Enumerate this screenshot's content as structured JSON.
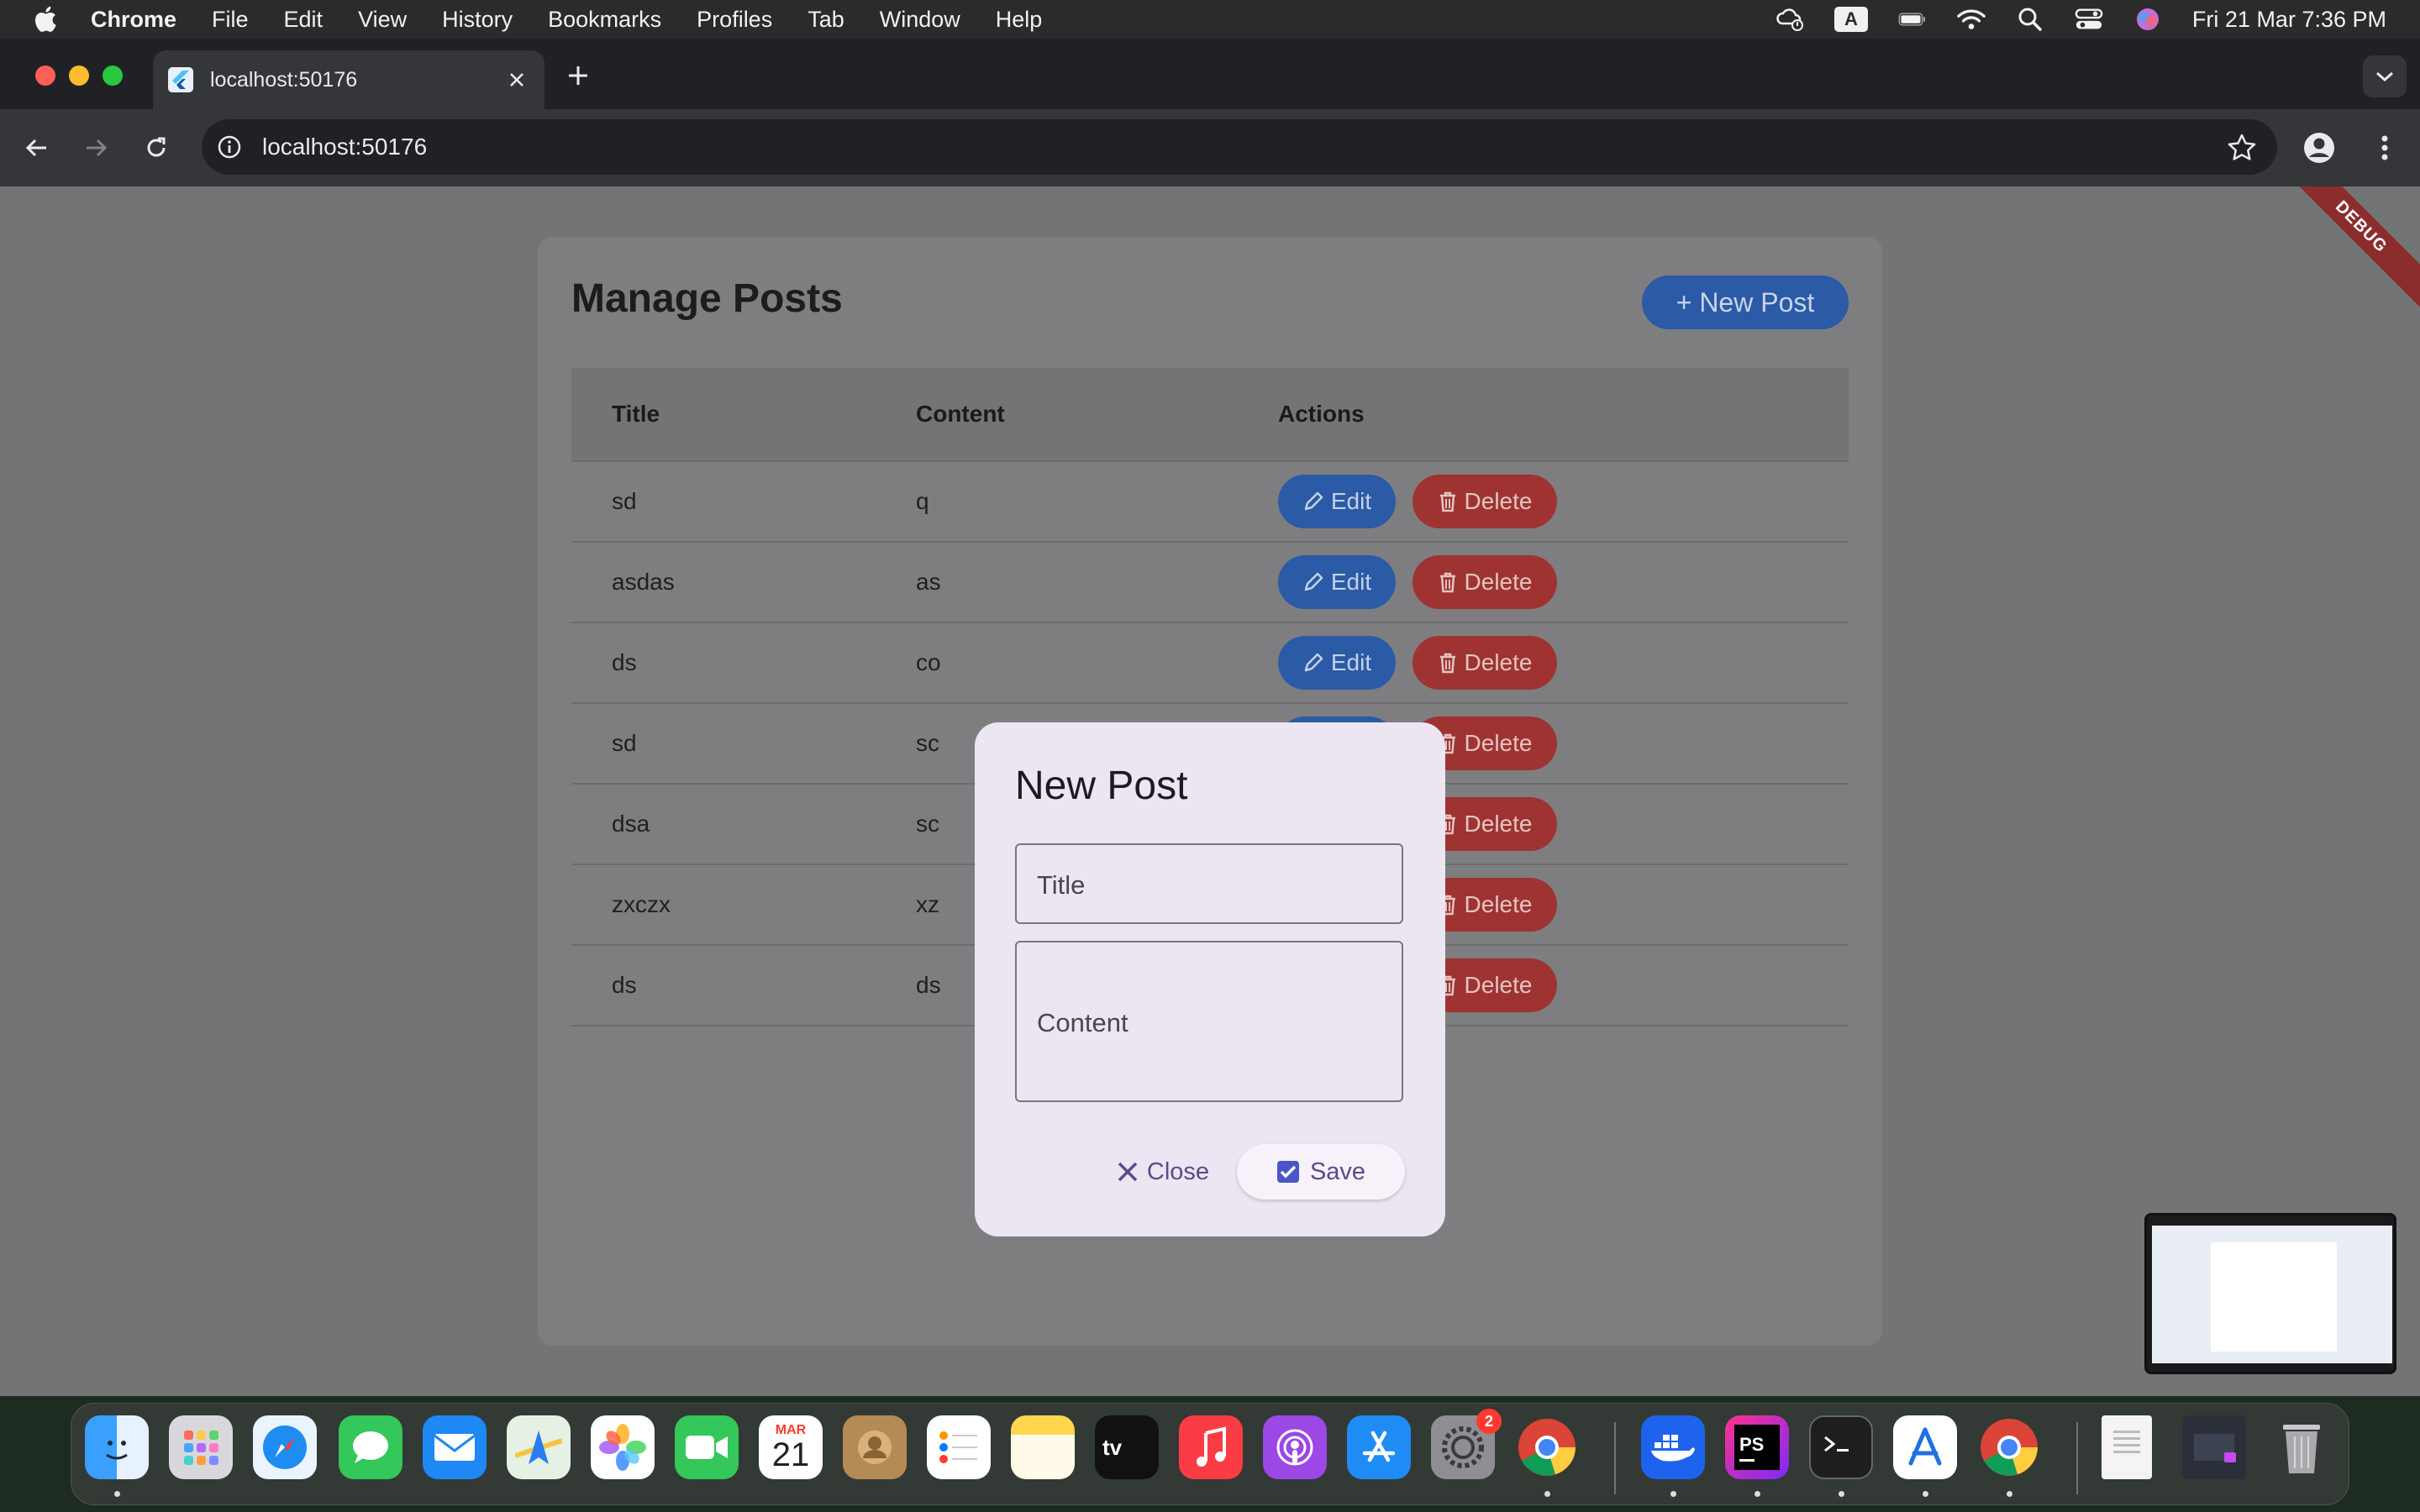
{
  "menubar": {
    "app_name": "Chrome",
    "items": [
      "File",
      "Edit",
      "View",
      "History",
      "Bookmarks",
      "Profiles",
      "Tab",
      "Window",
      "Help"
    ],
    "status_input_badge": "A",
    "datetime": "Fri 21 Mar  7:36 PM"
  },
  "browser": {
    "tab_title": "localhost:50176",
    "url": "localhost:50176"
  },
  "page": {
    "debug_banner": "DEBUG",
    "title": "Manage Posts",
    "new_post_button": "+ New Post",
    "columns": [
      "Title",
      "Content",
      "Actions"
    ],
    "rows": [
      {
        "title": "sd",
        "content": "q"
      },
      {
        "title": "asdas",
        "content": "as"
      },
      {
        "title": "ds",
        "content": "co"
      },
      {
        "title": "sd",
        "content": "sc"
      },
      {
        "title": "dsa",
        "content": "sc"
      },
      {
        "title": "zxczx",
        "content": "xz"
      },
      {
        "title": "ds",
        "content": "ds"
      }
    ],
    "edit_label": "Edit",
    "delete_label": "Delete"
  },
  "dialog": {
    "title": "New Post",
    "title_placeholder": "Title",
    "content_placeholder": "Content",
    "close_label": "Close",
    "save_label": "Save"
  },
  "dock": {
    "calendar_month": "MAR",
    "calendar_day": "21",
    "settings_badge": "2",
    "apps": [
      "finder",
      "launchpad",
      "safari",
      "messages",
      "mail",
      "maps",
      "photos",
      "facetime",
      "calendar",
      "contacts",
      "reminders",
      "notes",
      "tv",
      "music",
      "podcasts",
      "app-store",
      "system-settings",
      "chrome",
      "docker",
      "phpstorm",
      "terminal",
      "xcode-instruments",
      "chrome",
      "preview-document",
      "screenshot-window",
      "trash"
    ]
  },
  "colors": {
    "primary_blue": "#2b5aa6",
    "delete_red": "#9e3331",
    "dialog_bg": "#ece6f2",
    "dialog_accent": "#5b4b8a"
  }
}
